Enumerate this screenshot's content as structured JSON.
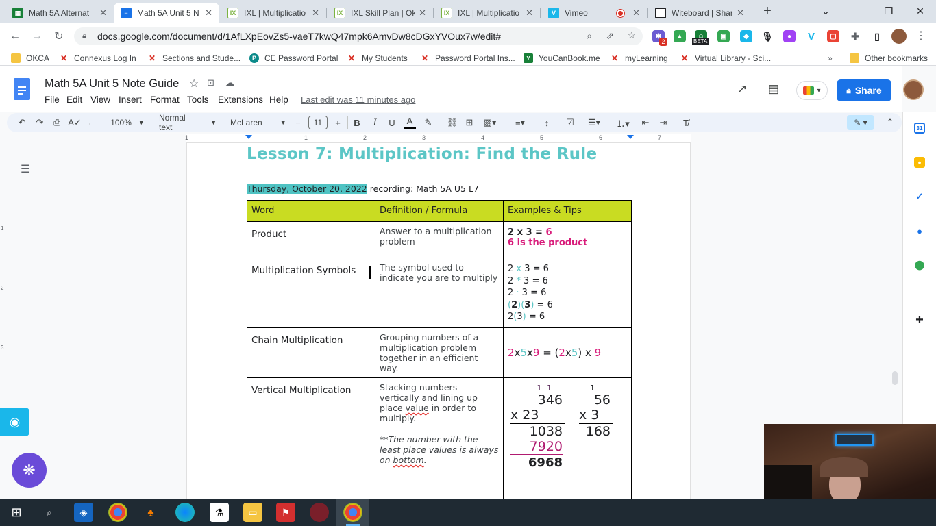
{
  "tabs": [
    {
      "title": "Math 5A Alternat",
      "icon": "sheets-icon",
      "color": "#188038"
    },
    {
      "title": "Math 5A Unit 5 N",
      "icon": "docs-icon",
      "color": "#1a73e8"
    },
    {
      "title": "IXL | Multiplicatio",
      "icon": "ixl-icon",
      "color": "#7cb342"
    },
    {
      "title": "IXL Skill Plan | Ok",
      "icon": "ixl-icon",
      "color": "#7cb342"
    },
    {
      "title": "IXL | Multiplicatio",
      "icon": "ixl-icon",
      "color": "#7cb342"
    },
    {
      "title": "Vimeo",
      "icon": "vimeo-icon",
      "color": "#1ab7ea"
    },
    {
      "title": "Witeboard | Shar",
      "icon": "whiteboard-icon",
      "color": "#202124"
    }
  ],
  "url": "docs.google.com/document/d/1AfLXpEovZs5-vaeT7kwQ47mpk6AmvDw8cDGxYVOux7w/edit#",
  "bookmarks": [
    "OKCA",
    "Connexus Log In",
    "Sections and Stude...",
    "CE Password Portal",
    "My Students",
    "Password Portal Ins...",
    "YouCanBook.me",
    "myLearning",
    "Virtual Library - Sci..."
  ],
  "other_bookmarks": "Other bookmarks",
  "ext_badge": "2",
  "ext_beta": "BETA",
  "doc": {
    "title": "Math 5A Unit 5 Note Guide",
    "menus": [
      "File",
      "Edit",
      "View",
      "Insert",
      "Format",
      "Tools",
      "Extensions",
      "Help"
    ],
    "last_edit": "Last edit was 11 minutes ago",
    "share": "Share"
  },
  "toolbar": {
    "zoom": "100%",
    "style": "Normal text",
    "font": "McLaren",
    "size": "11",
    "minus": "−",
    "plus": "+"
  },
  "ruler_numbers": [
    "1",
    "1",
    "2",
    "3",
    "4",
    "5",
    "6",
    "7"
  ],
  "left_ruler_numbers": [
    "1",
    "2",
    "3"
  ],
  "lesson": {
    "heading": "Lesson 7: Multiplication: Find the Rule",
    "date": "Thursday, October 20, 2022",
    "recording": " recording: Math 5A U5 L7"
  },
  "table": {
    "headers": [
      "Word",
      "Definition / Formula",
      "Examples & Tips"
    ],
    "rows": [
      {
        "word": "Product",
        "definition": "Answer to a multiplication problem",
        "ex_line1": "2 x 3 = ",
        "ex_line1_b": "6",
        "ex_line2": "6 is the product"
      },
      {
        "word": "Multiplication Symbols",
        "definition": "The symbol used to indicate you are to multiply",
        "symbols": [
          {
            "a": "2 ",
            "s": "x",
            "b": " 3 = 6"
          },
          {
            "a": "2 ",
            "s": "*",
            "b": " 3 = 6"
          },
          {
            "a": "2 ",
            "s": "·",
            "b": " 3 = 6"
          },
          {
            "a": "",
            "s": "(",
            "b": "2",
            "s2": ")(",
            "c": "3",
            "s3": ")",
            "d": " = 6"
          },
          {
            "a": "2",
            "s": "(",
            "b": "3",
            "s2": ")",
            "c": " = 6"
          }
        ]
      },
      {
        "word": "Chain Multiplication",
        "definition": "Grouping numbers of a multiplication problem together in an efficient way.",
        "chain": {
          "p1": "2",
          "x1": "x",
          "p2": "5",
          "x2": "x",
          "p3": "9",
          "eq": " = (",
          "p4": "2",
          "x3": "x",
          "p5": "5",
          "close": ") x ",
          "p6": "9"
        }
      },
      {
        "word": "Vertical Multiplication",
        "definition_a": "Stacking numbers vertically and lining up place ",
        "definition_value": "value",
        "definition_b": " in order to multiply.",
        "note_a": "**The number with the least place values is always on ",
        "note_b": "bottom",
        "hw1": {
          "carry": "1 1",
          "top": "346",
          "mult": "x  23",
          "p1": "1038",
          "p2": "7920",
          "sum": "6968"
        },
        "hw2": {
          "carry": "1",
          "top": "56",
          "mult": "x 3",
          "p1": "168"
        }
      }
    ]
  },
  "colors": {
    "accent": "#1a73e8",
    "header_green": "#c9dc22",
    "pink": "#d81b7a",
    "teal": "#5cc6c6",
    "highlight": "#4fc3c3"
  }
}
